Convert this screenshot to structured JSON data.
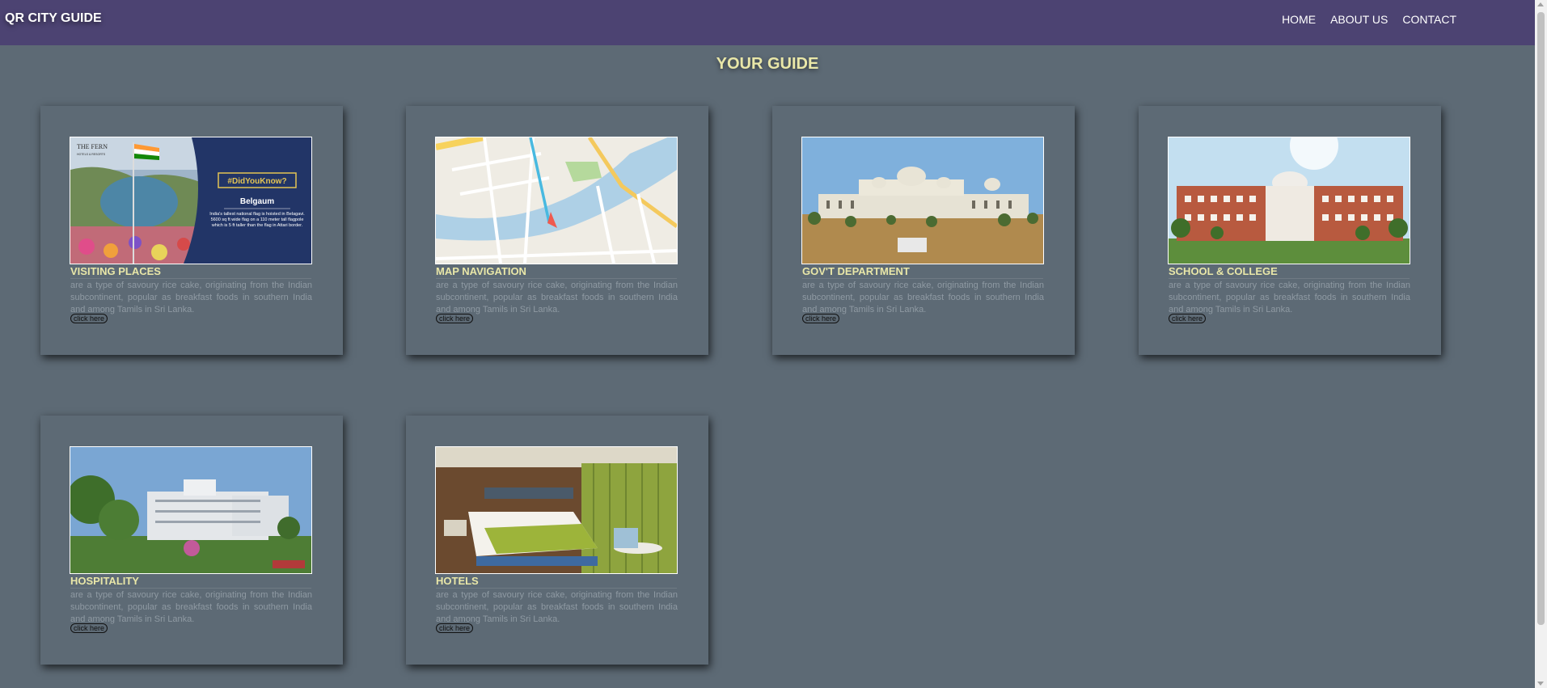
{
  "brand": "QR CITY GUIDE",
  "nav": {
    "home": "HOME",
    "about": "ABOUT US",
    "contact": "CONTACT"
  },
  "page_title": "YOUR GUIDE",
  "colors": {
    "navbar": "#4c4372",
    "background": "#5d6a75",
    "title": "#e9e7a8",
    "text_muted": "#8f9aa3"
  },
  "cards": [
    {
      "title": "VISITING PLACES",
      "description": "are a type of savoury rice cake, originating from the Indian subcontinent, popular as breakfast foods in southern India and among Tamils in Sri Lanka.",
      "button": "click here",
      "image": {
        "logo": "THE FERN",
        "logo_sub": "HOTELS & RESORTS",
        "badge": "#DidYouKnow?",
        "place": "Belgaum",
        "fact": "India's tallest national flag is hoisted in Belagavi. 5600 sq ft wide flag on a 110 meter tall flagpole which is 5 ft taller than the flag in Attari border."
      }
    },
    {
      "title": "MAP NAVIGATION",
      "description": "are a type of savoury rice cake, originating from the Indian subcontinent, popular as breakfast foods in southern India and among Tamils in Sri Lanka.",
      "button": "click here"
    },
    {
      "title": "GOV'T DEPARTMENT",
      "description": "are a type of savoury rice cake, originating from the Indian subcontinent, popular as breakfast foods in southern India and among Tamils in Sri Lanka.",
      "button": "click here"
    },
    {
      "title": "SCHOOL & COLLEGE",
      "description": "are a type of savoury rice cake, originating from the Indian subcontinent, popular as breakfast foods in southern India and among Tamils in Sri Lanka.",
      "button": "click here"
    },
    {
      "title": "HOSPITALITY",
      "description": "are a type of savoury rice cake, originating from the Indian subcontinent, popular as breakfast foods in southern India and among Tamils in Sri Lanka.",
      "button": "click here"
    },
    {
      "title": "HOTELS",
      "description": "are a type of savoury rice cake, originating from the Indian subcontinent, popular as breakfast foods in southern India and among Tamils in Sri Lanka.",
      "button": "click here"
    }
  ]
}
